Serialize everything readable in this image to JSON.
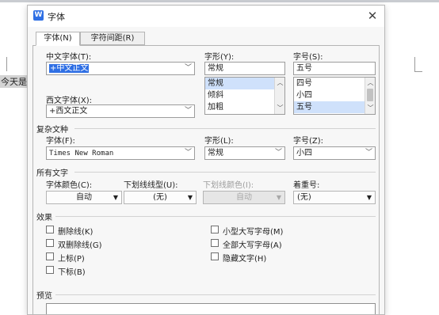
{
  "document": {
    "body_text": "今天是"
  },
  "dialog": {
    "title": "字体",
    "app_icon_glyph": "W",
    "tabs": [
      {
        "label": "字体(N)",
        "active": true
      },
      {
        "label": "字符间距(R)",
        "active": false
      }
    ],
    "west": {
      "cn_font_label": "中文字体(T):",
      "cn_font_value": "+中文正文",
      "west_font_label": "西文字体(X):",
      "west_font_value": "+西文正文"
    },
    "style": {
      "label": "字形(Y):",
      "value": "常规",
      "options": [
        "常规",
        "倾斜",
        "加粗"
      ],
      "selected_index": 0
    },
    "size": {
      "label": "字号(S):",
      "value": "五号",
      "options": [
        "四号",
        "小四",
        "五号"
      ],
      "selected_index": 2
    },
    "complex": {
      "section_label": "复杂文种",
      "font_label": "字体(F):",
      "font_value": "Times New Roman",
      "style_label": "字形(L):",
      "style_value": "常规",
      "size_label": "字号(Z):",
      "size_value": "小四"
    },
    "all_text": {
      "section_label": "所有文字",
      "color_label": "字体颜色(C):",
      "color_value": "自动",
      "underline_label": "下划线线型(U):",
      "underline_value": "(无)",
      "underline_color_label": "下划线颜色(I):",
      "underline_color_value": "自动",
      "emphasis_label": "着重号:",
      "emphasis_value": "(无)"
    },
    "effects": {
      "section_label": "效果",
      "left": [
        {
          "label": "删除线(K)",
          "checked": false
        },
        {
          "label": "双删除线(G)",
          "checked": false
        },
        {
          "label": "上标(P)",
          "checked": false
        },
        {
          "label": "下标(B)",
          "checked": false
        }
      ],
      "right": [
        {
          "label": "小型大写字母(M)",
          "checked": false
        },
        {
          "label": "全部大写字母(A)",
          "checked": false
        },
        {
          "label": "隐藏文字(H)",
          "checked": false
        }
      ]
    },
    "preview": {
      "section_label": "预览"
    }
  },
  "icons": {
    "close": "close-icon",
    "dropdown": "chevron-down-icon",
    "scroll_up": "chevron-up-icon",
    "scroll_down": "chevron-down-icon",
    "app": "wps-writer-icon"
  },
  "colors": {
    "accent": "#2f6fe4",
    "list_selected": "#cfe1fb",
    "dialog_bg": "#f7f7f7"
  }
}
